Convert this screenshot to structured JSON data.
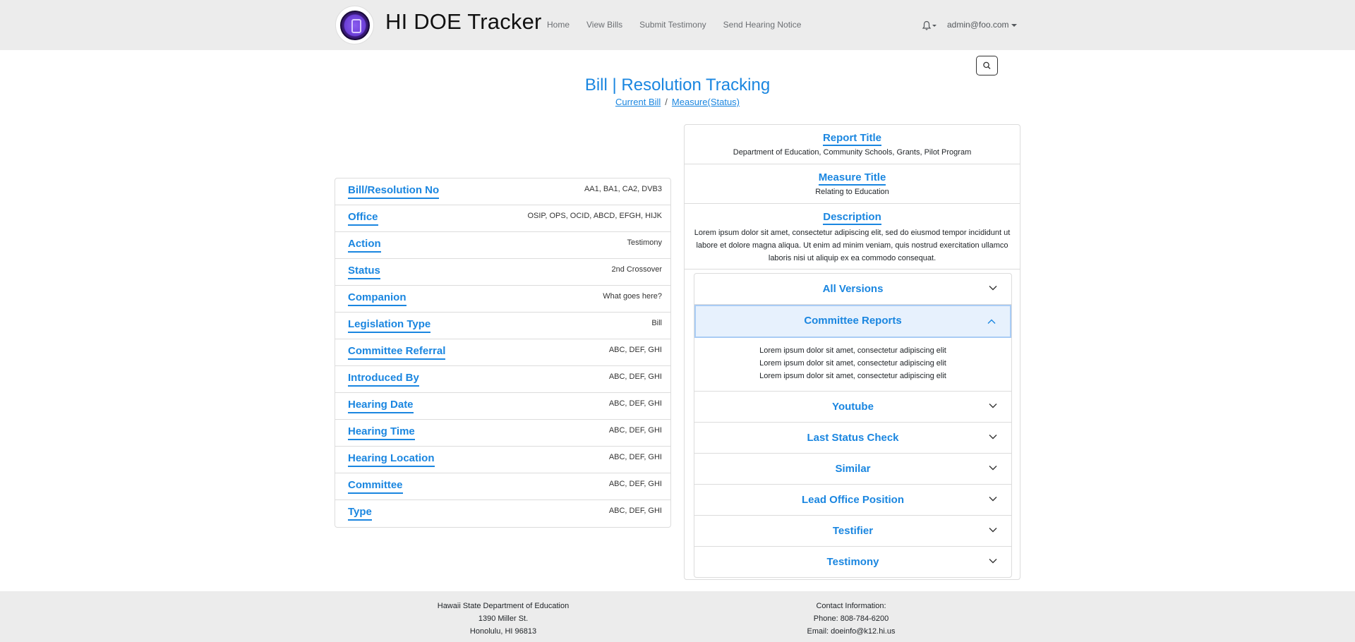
{
  "app": {
    "brand": "HI DOE Tracker"
  },
  "nav": {
    "links": [
      "Home",
      "View Bills",
      "Submit Testimony",
      "Send Hearing Notice"
    ],
    "user": "admin@foo.com"
  },
  "page": {
    "title": "Bill | Resolution Tracking",
    "breadcrumb": [
      "Current Bill",
      "Measure(Status)"
    ]
  },
  "details": [
    {
      "label": "Bill/Resolution No",
      "value": "AA1, BA1, CA2, DVB3"
    },
    {
      "label": "Office",
      "value": "OSIP, OPS, OCID, ABCD, EFGH, HIJK"
    },
    {
      "label": "Action",
      "value": "Testimony"
    },
    {
      "label": "Status",
      "value": "2nd Crossover"
    },
    {
      "label": "Companion",
      "value": "What goes here?"
    },
    {
      "label": "Legislation Type",
      "value": "Bill"
    },
    {
      "label": "Committee Referral",
      "value": "ABC, DEF, GHI"
    },
    {
      "label": "Introduced By",
      "value": "ABC, DEF, GHI"
    },
    {
      "label": "Hearing Date",
      "value": "ABC, DEF, GHI"
    },
    {
      "label": "Hearing Time",
      "value": "ABC, DEF, GHI"
    },
    {
      "label": "Hearing Location",
      "value": "ABC, DEF, GHI"
    },
    {
      "label": "Committee",
      "value": "ABC, DEF, GHI"
    },
    {
      "label": "Type",
      "value": "ABC, DEF, GHI"
    }
  ],
  "report": {
    "report_title_label": "Report Title",
    "report_title": "Department of Education, Community Schools, Grants, Pilot Program",
    "measure_title_label": "Measure Title",
    "measure_title": "Relating to Education",
    "description_label": "Description",
    "description": "Lorem ipsum dolor sit amet, consectetur adipiscing elit, sed do eiusmod tempor incididunt ut labore et dolore magna aliqua. Ut enim ad minim veniam, quis nostrud exercitation ullamco laboris nisi ut aliquip ex ea commodo consequat."
  },
  "accordion": [
    {
      "label": "All Versions",
      "open": false
    },
    {
      "label": "Committee Reports",
      "open": true,
      "lines": [
        "Lorem ipsum dolor sit amet, consectetur adipiscing elit",
        "Lorem ipsum dolor sit amet, consectetur adipiscing elit",
        "Lorem ipsum dolor sit amet, consectetur adipiscing elit"
      ]
    },
    {
      "label": "Youtube",
      "open": false
    },
    {
      "label": "Last Status Check",
      "open": false
    },
    {
      "label": "Similar",
      "open": false
    },
    {
      "label": "Lead Office Position",
      "open": false
    },
    {
      "label": "Testifier",
      "open": false
    },
    {
      "label": "Testimony",
      "open": false
    }
  ],
  "footer": {
    "left": [
      "Hawaii State Department of Education",
      "1390 Miller St.",
      "Honolulu, HI 96813"
    ],
    "right": [
      "Contact Information:",
      "Phone: 808-784-6200",
      "Email: doeinfo@k12.hi.us"
    ]
  },
  "colors": {
    "accent": "#1a86e0",
    "navbar": "#ececec",
    "open_header": "#e7f1fd"
  }
}
